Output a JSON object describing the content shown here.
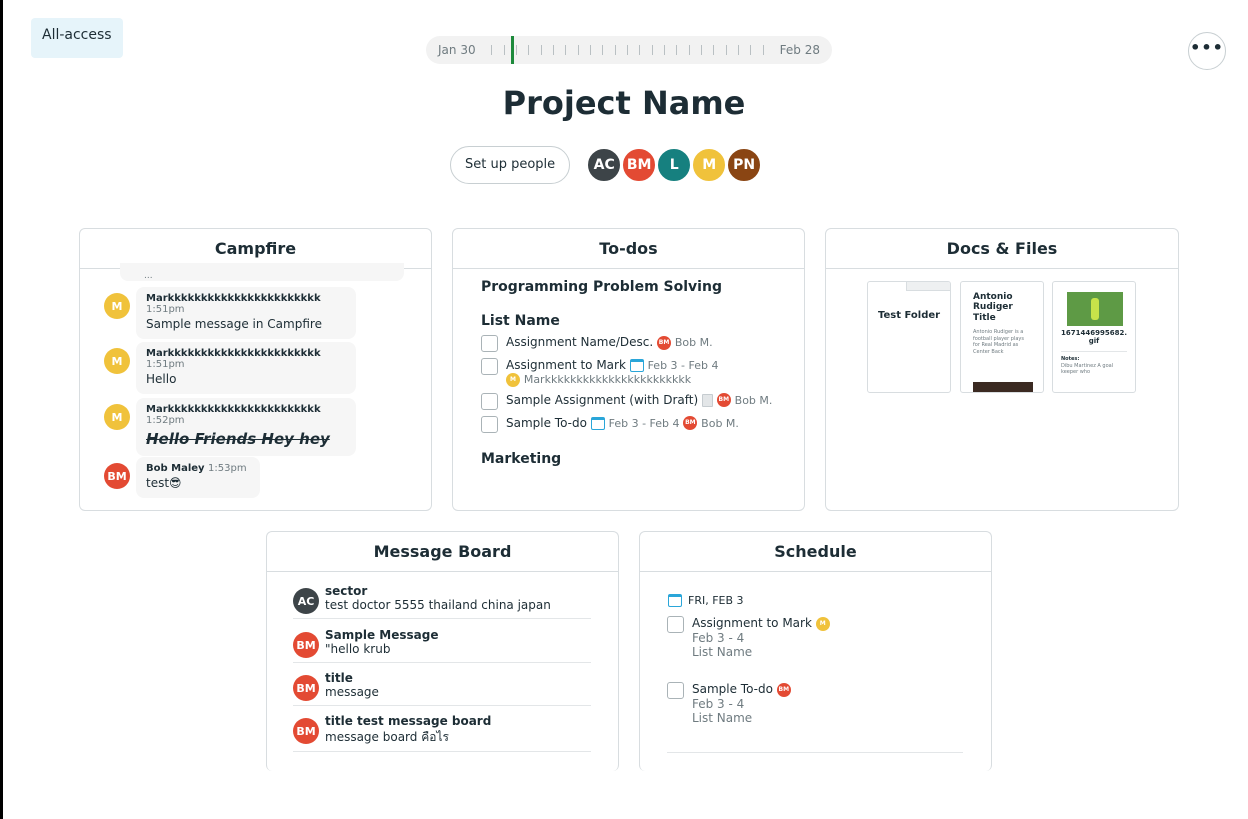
{
  "access_badge": "All-access",
  "timeline": {
    "start": "Jan 30",
    "end": "Feb 28"
  },
  "project": {
    "title": "Project Name",
    "setup_people": "Set up people"
  },
  "people": [
    {
      "initials": "AC",
      "color": "#3d4448"
    },
    {
      "initials": "BM",
      "color": "#e34a33"
    },
    {
      "initials": "L",
      "color": "#16807f"
    },
    {
      "initials": "M",
      "color": "#f0c23b"
    },
    {
      "initials": "PN",
      "color": "#8a4513"
    }
  ],
  "campfire": {
    "title": "Campfire",
    "top_fragment": "...",
    "messages": [
      {
        "initials": "M",
        "color": "#f0c23b",
        "name": "Markkkkkkkkkkkkkkkkkkkkkkk",
        "time": "1:51pm",
        "text": "Sample message in Campfire"
      },
      {
        "initials": "M",
        "color": "#f0c23b",
        "name": "Markkkkkkkkkkkkkkkkkkkkkkk",
        "time": "1:51pm",
        "text": "Hello"
      },
      {
        "initials": "M",
        "color": "#f0c23b",
        "name": "Markkkkkkkkkkkkkkkkkkkkkkk",
        "time": "1:52pm",
        "text": "Hello Friends Hey hey"
      },
      {
        "initials": "BM",
        "color": "#e34a33",
        "name": "Bob Maley",
        "time": "1:53pm",
        "text": "test😎"
      }
    ]
  },
  "todos": {
    "title": "To-dos",
    "project_heading": "Programming Problem Solving",
    "list_name": "List Name",
    "items": [
      {
        "label": "Assignment Name/Desc.",
        "assignee": "Bob M."
      },
      {
        "label": "Assignment to Mark",
        "dates": "Feb 3 - Feb 4",
        "assignee": "Markkkkkkkkkkkkkkkkkkkkkkk"
      },
      {
        "label": "Sample Assignment (with Draft)",
        "assignee": "Bob M."
      },
      {
        "label": "Sample To-do",
        "dates": "Feb 3 - Feb 4",
        "assignee": "Bob M."
      }
    ],
    "second_heading": "Marketing"
  },
  "docs": {
    "title": "Docs & Files",
    "folder": "Test Folder",
    "doc": {
      "title": "Antonio Rudiger Title",
      "excerpt": "Antonio Rudiger is a football player plays for Real Madrid as Center Back"
    },
    "image": {
      "name": "1671446995682.gif",
      "notes_label": "Notes:",
      "notes": "Dibu Martinez A goal keeper who"
    }
  },
  "message_board": {
    "title": "Message Board",
    "posts": [
      {
        "initials": "AC",
        "color": "#3d4448",
        "title": "sector",
        "text": "test doctor 5555 thailand china japan"
      },
      {
        "initials": "BM",
        "color": "#e34a33",
        "title": "Sample Message",
        "text": "\"hello krub"
      },
      {
        "initials": "BM",
        "color": "#e34a33",
        "title": "title",
        "text": "message"
      },
      {
        "initials": "BM",
        "color": "#e34a33",
        "title": "title test message board",
        "text": "message board คือไร"
      }
    ]
  },
  "schedule": {
    "title": "Schedule",
    "date": "FRI, FEB 3",
    "events": [
      {
        "label": "Assignment to Mark",
        "dates": "Feb 3 - 4",
        "list": "List Name",
        "assignee_color": "#f0c23b",
        "assignee_initials": "M"
      },
      {
        "label": "Sample To-do",
        "dates": "Feb 3 - 4",
        "list": "List Name",
        "assignee_color": "#e34a33",
        "assignee_initials": "BM"
      }
    ]
  }
}
